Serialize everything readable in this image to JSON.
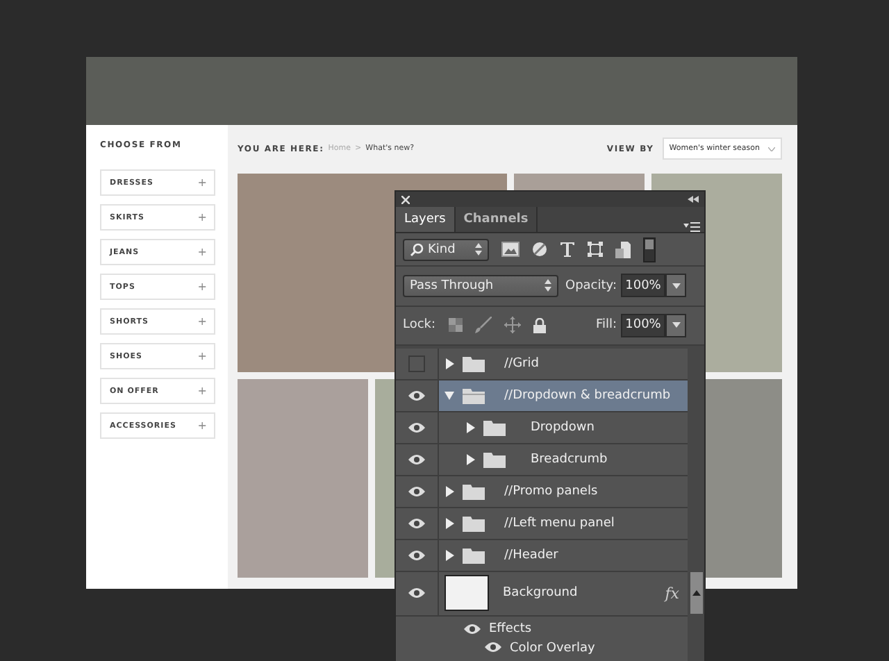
{
  "sidebar": {
    "title": "CHOOSE FROM",
    "items": [
      {
        "label": "DRESSES",
        "icon": "+"
      },
      {
        "label": "SKIRTS",
        "icon": "+"
      },
      {
        "label": "JEANS",
        "icon": "+"
      },
      {
        "label": "TOPS",
        "icon": "+"
      },
      {
        "label": "SHORTS",
        "icon": "+"
      },
      {
        "label": "SHOES",
        "icon": "+"
      },
      {
        "label": "ON OFFER",
        "icon": "+"
      },
      {
        "label": "ACCESSORIES",
        "icon": "+"
      }
    ]
  },
  "breadcrumb": {
    "label": "YOU ARE HERE:",
    "home": "Home",
    "separator": ">",
    "current": "What's new?"
  },
  "view_by": {
    "label": "VIEW BY",
    "value": "Women's winter season"
  },
  "tiles": [
    {
      "color": "#9c8b7e",
      "wide": true
    },
    {
      "color": "#a99f98",
      "wide": false
    },
    {
      "color": "#abad9e",
      "wide": false
    },
    {
      "color": "#aaa09c",
      "wide": false
    },
    {
      "color": "#a8ad9c",
      "wide": true
    },
    {
      "color": "#8d8d87",
      "wide": false
    }
  ],
  "layers_panel": {
    "tabs": [
      {
        "label": "Layers",
        "selected": true
      },
      {
        "label": "Channels",
        "selected": false
      }
    ],
    "filter": "Kind",
    "blend_mode": "Pass Through",
    "opacity": {
      "label": "Opacity:",
      "value": "100%"
    },
    "lock_label": "Lock:",
    "fill": {
      "label": "Fill:",
      "value": "100%"
    },
    "layers": [
      {
        "kind": "group",
        "name": "//Grid",
        "visible": false,
        "expanded": false,
        "selected": false
      },
      {
        "kind": "group",
        "name": "//Dropdown & breadcrumb",
        "visible": true,
        "expanded": true,
        "selected": true,
        "children": [
          {
            "kind": "group",
            "name": "Dropdown",
            "visible": true,
            "expanded": false,
            "selected": false
          },
          {
            "kind": "group",
            "name": "Breadcrumb",
            "visible": true,
            "expanded": false,
            "selected": false
          }
        ]
      },
      {
        "kind": "group",
        "name": "//Promo panels",
        "visible": true,
        "expanded": false,
        "selected": false
      },
      {
        "kind": "group",
        "name": "//Left menu panel",
        "visible": true,
        "expanded": false,
        "selected": false
      },
      {
        "kind": "group",
        "name": "//Header",
        "visible": true,
        "expanded": false,
        "selected": false
      },
      {
        "kind": "image",
        "name": "Background",
        "visible": true,
        "selected": false,
        "fx": "fx",
        "effects": {
          "label": "Effects",
          "items": [
            "Color Overlay"
          ]
        }
      }
    ]
  }
}
